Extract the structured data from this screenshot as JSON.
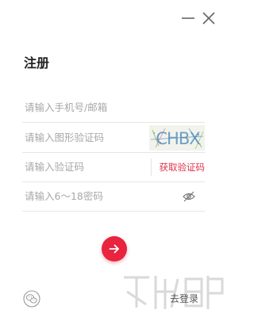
{
  "window": {
    "minimize_icon": "minimize-icon",
    "close_icon": "close-icon"
  },
  "form": {
    "title": "注册",
    "account_placeholder": "请输入手机号/邮箱",
    "captcha_placeholder": "请输入图形验证码",
    "captcha_text": "CHBX",
    "sms_code_placeholder": "请输入验证码",
    "get_code_label": "获取验证码",
    "password_placeholder": "请输入6～18密码",
    "password_toggle_icon": "eye-off-icon",
    "submit_icon": "arrow-right-icon"
  },
  "footer": {
    "social_icon": "wechat-icon",
    "login_link": "去登录"
  },
  "colors": {
    "accent": "#e8243f",
    "link_red": "#e0334a",
    "placeholder": "#a8a8a8",
    "divider": "#e6e6e6"
  }
}
